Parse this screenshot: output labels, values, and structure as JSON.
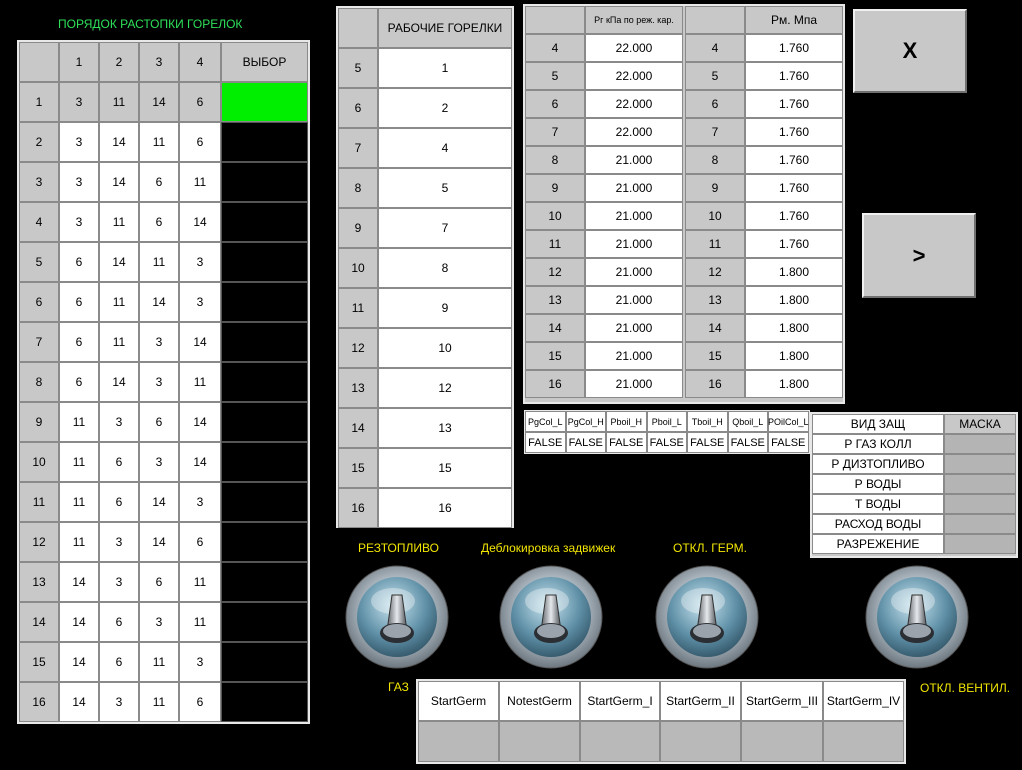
{
  "firing_order": {
    "title": "ПОРЯДОК РАСТОПКИ ГОРЕЛОК",
    "headers": [
      "1",
      "2",
      "3",
      "4"
    ],
    "select_header": "ВЫБОР",
    "rows": [
      {
        "n": "1",
        "v": [
          "3",
          "11",
          "14",
          "6"
        ],
        "selected": true
      },
      {
        "n": "2",
        "v": [
          "3",
          "14",
          "11",
          "6"
        ]
      },
      {
        "n": "3",
        "v": [
          "3",
          "14",
          "6",
          "11"
        ]
      },
      {
        "n": "4",
        "v": [
          "3",
          "11",
          "6",
          "14"
        ]
      },
      {
        "n": "5",
        "v": [
          "6",
          "14",
          "11",
          "3"
        ]
      },
      {
        "n": "6",
        "v": [
          "6",
          "11",
          "14",
          "3"
        ]
      },
      {
        "n": "7",
        "v": [
          "6",
          "11",
          "3",
          "14"
        ]
      },
      {
        "n": "8",
        "v": [
          "6",
          "14",
          "3",
          "11"
        ]
      },
      {
        "n": "9",
        "v": [
          "11",
          "3",
          "6",
          "14"
        ]
      },
      {
        "n": "10",
        "v": [
          "11",
          "6",
          "3",
          "14"
        ]
      },
      {
        "n": "11",
        "v": [
          "11",
          "6",
          "14",
          "3"
        ]
      },
      {
        "n": "12",
        "v": [
          "11",
          "3",
          "14",
          "6"
        ]
      },
      {
        "n": "13",
        "v": [
          "14",
          "3",
          "6",
          "11"
        ]
      },
      {
        "n": "14",
        "v": [
          "14",
          "6",
          "3",
          "11"
        ]
      },
      {
        "n": "15",
        "v": [
          "14",
          "6",
          "11",
          "3"
        ]
      },
      {
        "n": "16",
        "v": [
          "14",
          "3",
          "11",
          "6"
        ]
      }
    ],
    "select_color": "#00ee00"
  },
  "working_burners": {
    "header": "РАБОЧИЕ ГОРЕЛКИ",
    "rows": [
      {
        "n": "5",
        "v": "1"
      },
      {
        "n": "6",
        "v": "2"
      },
      {
        "n": "7",
        "v": "4"
      },
      {
        "n": "8",
        "v": "5"
      },
      {
        "n": "9",
        "v": "7"
      },
      {
        "n": "10",
        "v": "8"
      },
      {
        "n": "11",
        "v": "9"
      },
      {
        "n": "12",
        "v": "10"
      },
      {
        "n": "13",
        "v": "12"
      },
      {
        "n": "14",
        "v": "13"
      },
      {
        "n": "15",
        "v": "15"
      },
      {
        "n": "16",
        "v": "16"
      }
    ]
  },
  "pressure_table": {
    "header_pg": "Рг кПа по реж. кар.",
    "header_pm": "Рм. Мпа",
    "rows": [
      {
        "n": "4",
        "pg": "22.000",
        "pm": "1.760"
      },
      {
        "n": "5",
        "pg": "22.000",
        "pm": "1.760"
      },
      {
        "n": "6",
        "pg": "22.000",
        "pm": "1.760"
      },
      {
        "n": "7",
        "pg": "22.000",
        "pm": "1.760"
      },
      {
        "n": "8",
        "pg": "21.000",
        "pm": "1.760"
      },
      {
        "n": "9",
        "pg": "21.000",
        "pm": "1.760"
      },
      {
        "n": "10",
        "pg": "21.000",
        "pm": "1.760"
      },
      {
        "n": "11",
        "pg": "21.000",
        "pm": "1.760"
      },
      {
        "n": "12",
        "pg": "21.000",
        "pm": "1.800"
      },
      {
        "n": "13",
        "pg": "21.000",
        "pm": "1.800"
      },
      {
        "n": "14",
        "pg": "21.000",
        "pm": "1.800"
      },
      {
        "n": "15",
        "pg": "21.000",
        "pm": "1.800"
      },
      {
        "n": "16",
        "pg": "21.000",
        "pm": "1.800"
      }
    ]
  },
  "flags": {
    "headers": [
      "PgCol_L",
      "PgCol_H",
      "Pboil_H",
      "Pboil_L",
      "Tboil_H",
      "Qboil_L",
      "POilCol_L"
    ],
    "values": [
      "FALSE",
      "FALSE",
      "FALSE",
      "FALSE",
      "FALSE",
      "FALSE",
      "FALSE"
    ]
  },
  "protection": {
    "header_type": "ВИД ЗАЩ",
    "header_mask": "МАСКА",
    "rows": [
      "Р ГАЗ КОЛЛ",
      "Р ДИЗТОПЛИВО",
      "Р ВОДЫ",
      "Т ВОДЫ",
      "РАСХОД ВОДЫ",
      "РАЗРЕЖЕНИЕ"
    ]
  },
  "buttons": {
    "close": "X",
    "next": ">"
  },
  "switches": {
    "reserve_fuel": "РЕЗТОПЛИВО",
    "gas": "ГАЗ",
    "unlock_valves": "Деблокировка задвижек",
    "herm_off": "ОТКЛ. ГЕРМ.",
    "fan_off": "ОТКЛ. ВЕНТИЛ."
  },
  "start_table": {
    "headers": [
      "StartGerm",
      "NotestGerm",
      "StartGerm_I",
      "StartGerm_II",
      "StartGerm_III",
      "StartGerm_IV"
    ]
  }
}
